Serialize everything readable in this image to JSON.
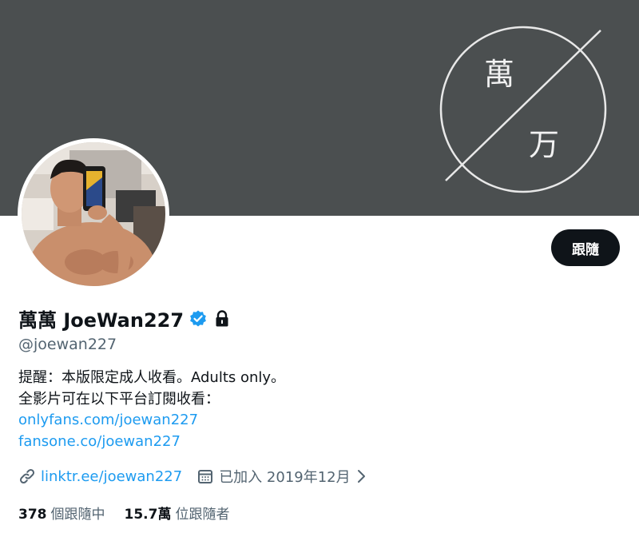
{
  "banner": {
    "glyph_top": "萬",
    "glyph_bottom": "万"
  },
  "profile": {
    "display_name": "萬萬 JoeWan227",
    "handle": "@joewan227",
    "verified_icon": "verified-badge-icon",
    "protected_icon": "lock-icon",
    "follow_label": "跟隨",
    "bio": {
      "line1": "提醒：本版限定成人收看。Adults only。",
      "line2": "全影片可在以下平台訂閱收看：",
      "link1": "onlyfans.com/joewan227",
      "link2": "fansone.co/joewan227"
    },
    "meta": {
      "website": "linktr.ee/joewan227",
      "joined": "已加入 2019年12月",
      "link_icon": "link-icon",
      "calendar_icon": "calendar-icon",
      "chevron_icon": "chevron-right-icon"
    },
    "stats": {
      "following_count": "378",
      "following_label": "個跟隨中",
      "followers_count": "15.7萬",
      "followers_label": "位跟隨者"
    }
  },
  "colors": {
    "banner_bg": "#4b4f50",
    "link": "#1d9bf0",
    "verified": "#1d9bf0",
    "secondary_text": "#536471",
    "button_bg": "#0f1419"
  }
}
